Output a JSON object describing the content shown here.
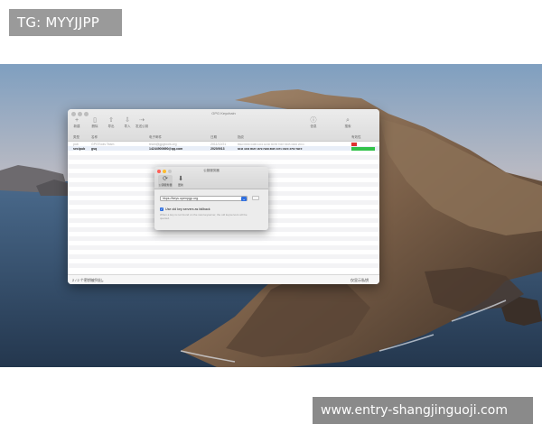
{
  "watermarks": {
    "top_left": "TG: MYYJJPP",
    "bottom_right": "www.entry-shangjinguoji.com"
  },
  "app": {
    "window_title": "GPG Keychain",
    "toolbar": {
      "buttons": [
        {
          "label": "新建",
          "icon": "plus-icon"
        },
        {
          "label": "删除",
          "icon": "trash-icon"
        },
        {
          "label": "导出",
          "icon": "export-icon"
        },
        {
          "label": "导入",
          "icon": "import-icon"
        },
        {
          "label": "发送公钥",
          "icon": "send-icon"
        }
      ],
      "info_label": "信息",
      "search_label": "搜索"
    },
    "columns": [
      "类型",
      "名称",
      "电子邮件",
      "日期",
      "指纹",
      "有效性"
    ],
    "keys": [
      {
        "type": "pub",
        "name": "GPGTools Team",
        "email": "team@gpgtools.org",
        "date": "2011/12/21",
        "fingerprint": "85E3 8F69 046B 44C1 EC9F B07B 76D7 8F05 00D0 26C4",
        "validity_color": "#e03030"
      },
      {
        "type": "sec/pub",
        "name": "gsq",
        "email": "14244900690@qq.com",
        "date": "2020/9/13",
        "fingerprint": "8242 4403 852F 1879 7B48 8825 4371 C62C 3752 7BFF",
        "validity_color": "#32c24a"
      }
    ],
    "status": {
      "count_text": "2 / 2 个密钥被列出。",
      "right_text": "仅显示私钥"
    }
  },
  "preferences": {
    "title": "公钥服务器",
    "tabs": [
      {
        "label": "公钥服务器",
        "icon": "refresh-icon",
        "selected": true
      },
      {
        "label": "更新",
        "icon": "download-icon",
        "selected": false
      }
    ],
    "keyserver_value": "hkps://keys.openpgp.org",
    "fallback_checkbox": {
      "label": "Use old key servers as fallback",
      "checked": true
    },
    "hint_text": "When a key is not found on the new keyserver, the old keyservers will be queried."
  }
}
